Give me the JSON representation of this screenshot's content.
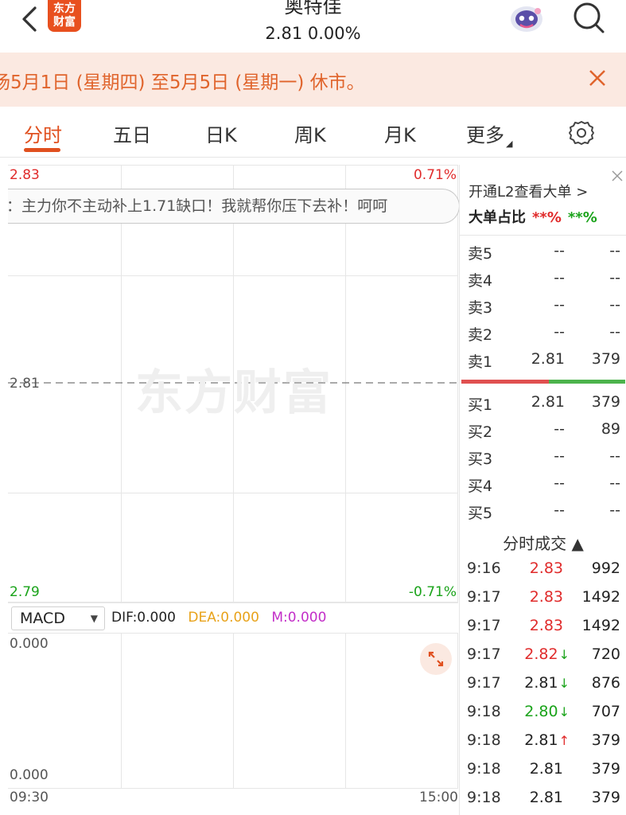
{
  "header": {
    "stock_name": "奥特佳",
    "quote": "2.81  0.00%",
    "logo_line1": "东方",
    "logo_line2": "财富"
  },
  "banner": {
    "text": "场5月1日 (星期四) 至5月5日 (星期一) 休市。"
  },
  "tabs": [
    {
      "label": "分时",
      "active": true
    },
    {
      "label": "五日"
    },
    {
      "label": "日K"
    },
    {
      "label": "周K"
    },
    {
      "label": "月K"
    },
    {
      "label": "更多"
    }
  ],
  "chart": {
    "high_price": "2.83",
    "high_pct": "0.71%",
    "mid_price": "2.81",
    "low_price": "2.79",
    "low_pct": "-0.71%",
    "comment": "：主力你不主动补上1.71缺口！我就帮你压下去补！呵呵",
    "watermark": "东方财富",
    "colors": {
      "up": "#e02b2b",
      "down": "#1aa31a",
      "accent": "#e0501f"
    }
  },
  "macd": {
    "selector": "MACD",
    "dif": "DIF:0.000",
    "dea": "DEA:0.000",
    "m": "M:0.000",
    "top_value": "0.000",
    "bottom_value": "0.000",
    "time_start": "09:30",
    "time_end": "15:00"
  },
  "level2": {
    "title": "开通L2查看大单 >",
    "ratio_label": "大单占比",
    "ratio_red": "**%",
    "ratio_green": "**%"
  },
  "orderbook": {
    "asks": [
      {
        "label": "卖5",
        "price": "--",
        "vol": "--"
      },
      {
        "label": "卖4",
        "price": "--",
        "vol": "--"
      },
      {
        "label": "卖3",
        "price": "--",
        "vol": "--"
      },
      {
        "label": "卖2",
        "price": "--",
        "vol": "--"
      },
      {
        "label": "卖1",
        "price": "2.81",
        "vol": "379"
      }
    ],
    "bids": [
      {
        "label": "买1",
        "price": "2.81",
        "vol": "379"
      },
      {
        "label": "买2",
        "price": "--",
        "vol": "89"
      },
      {
        "label": "买3",
        "price": "--",
        "vol": "--"
      },
      {
        "label": "买4",
        "price": "--",
        "vol": "--"
      },
      {
        "label": "买5",
        "price": "--",
        "vol": "--"
      }
    ]
  },
  "trades": {
    "title": "分时成交 ▲",
    "rows": [
      {
        "time": "9:16",
        "price": "2.83",
        "dir": "",
        "color": "red",
        "vol": "992"
      },
      {
        "time": "9:17",
        "price": "2.83",
        "dir": "",
        "color": "red",
        "vol": "1492"
      },
      {
        "time": "9:17",
        "price": "2.83",
        "dir": "",
        "color": "red",
        "vol": "1492"
      },
      {
        "time": "9:17",
        "price": "2.82",
        "dir": "↓",
        "color": "red",
        "vol": "720"
      },
      {
        "time": "9:17",
        "price": "2.81",
        "dir": "↓",
        "color": "black",
        "vol": "876"
      },
      {
        "time": "9:18",
        "price": "2.80",
        "dir": "↓",
        "color": "green",
        "vol": "707"
      },
      {
        "time": "9:18",
        "price": "2.81",
        "dir": "↑",
        "color": "black",
        "vol": "379"
      },
      {
        "time": "9:18",
        "price": "2.81",
        "dir": "",
        "color": "black",
        "vol": "379"
      },
      {
        "time": "9:18",
        "price": "2.81",
        "dir": "",
        "color": "black",
        "vol": "379"
      }
    ]
  }
}
